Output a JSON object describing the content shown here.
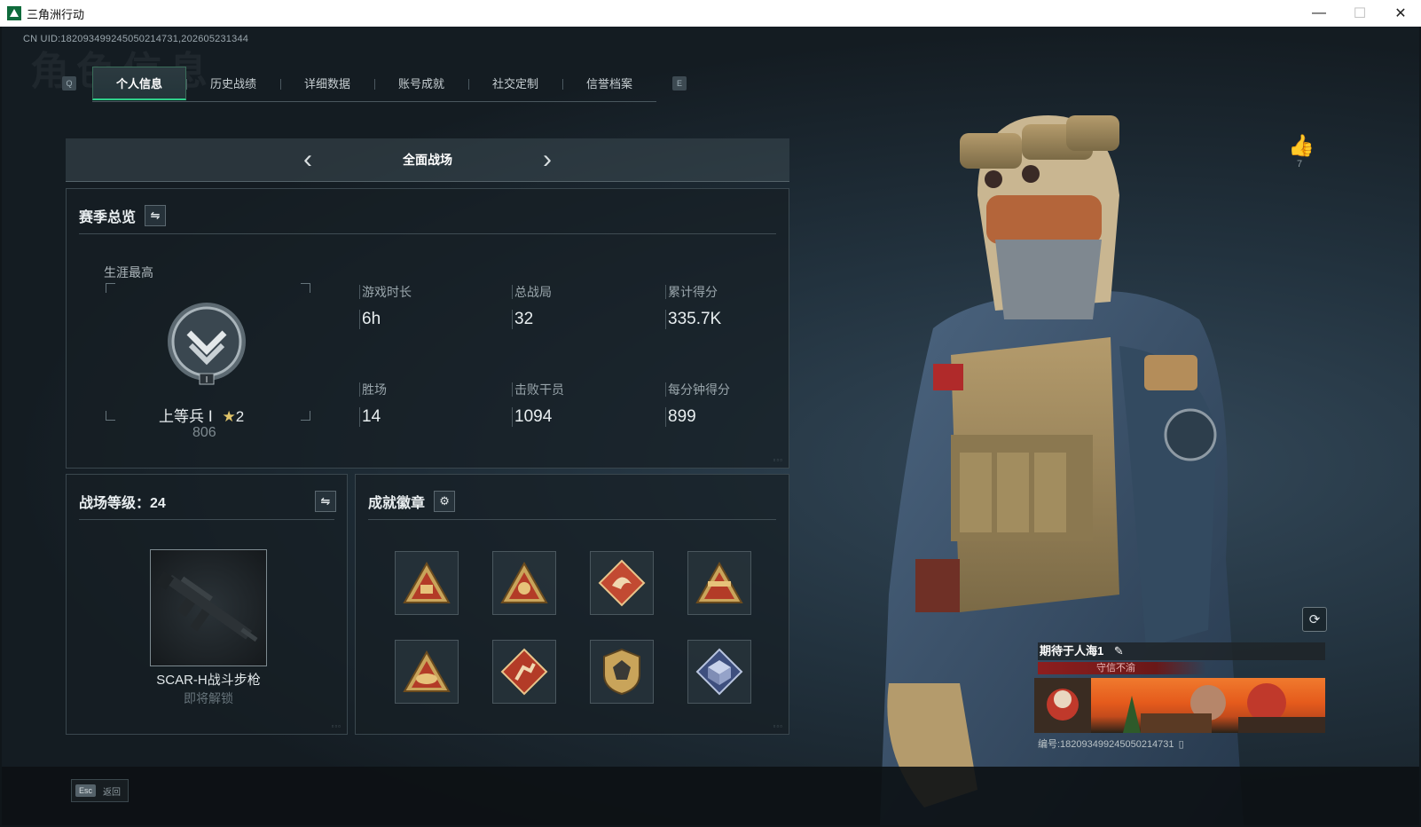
{
  "window": {
    "title": "三角洲行动",
    "controls": [
      "—",
      "☐",
      "✕"
    ]
  },
  "uid_text": "CN UID:18209349924505021473​1,202605231344",
  "bg_title": "角色信息",
  "tabs": {
    "left_key": "Q",
    "right_key": "E",
    "items": [
      "个人信息",
      "历史战绩",
      "详细数据",
      "账号成就",
      "社交定制",
      "信誉档案"
    ],
    "active": 0
  },
  "mode": {
    "title": "全面战场",
    "prev": "‹",
    "next": "›"
  },
  "season": {
    "title": "赛季总览",
    "career_label": "生涯最高",
    "rank": {
      "name": "上等兵 Ⅰ",
      "stars": "2",
      "points": "806",
      "tier": "I"
    },
    "stats": [
      {
        "label": "游戏时长",
        "value": "6h"
      },
      {
        "label": "总战局",
        "value": "32"
      },
      {
        "label": "累计得分",
        "value": "335.7K"
      },
      {
        "label": "胜场",
        "value": "14"
      },
      {
        "label": "击败干员",
        "value": "1094"
      },
      {
        "label": "每分钟得分",
        "value": "899"
      }
    ]
  },
  "level": {
    "title": "战场等级：24",
    "weapon_name": "SCAR-H战斗步枪",
    "weapon_status": "即将解锁"
  },
  "badges": {
    "title": "成就徽章",
    "items": [
      "badge-sb",
      "badge-soldier",
      "badge-dragon",
      "badge-tower",
      "badge-hat",
      "badge-runner",
      "badge-shield",
      "badge-cube"
    ]
  },
  "profile": {
    "likes": "7",
    "player_name": "期待于人海1",
    "tag": "守信不渝",
    "id_text": "编号:18209349924505021473​1"
  },
  "footer": {
    "esc_key": "Esc",
    "esc_label": "返回"
  },
  "colors": {
    "accent": "#2fd08a",
    "tag_red": "#8e1e1e"
  }
}
